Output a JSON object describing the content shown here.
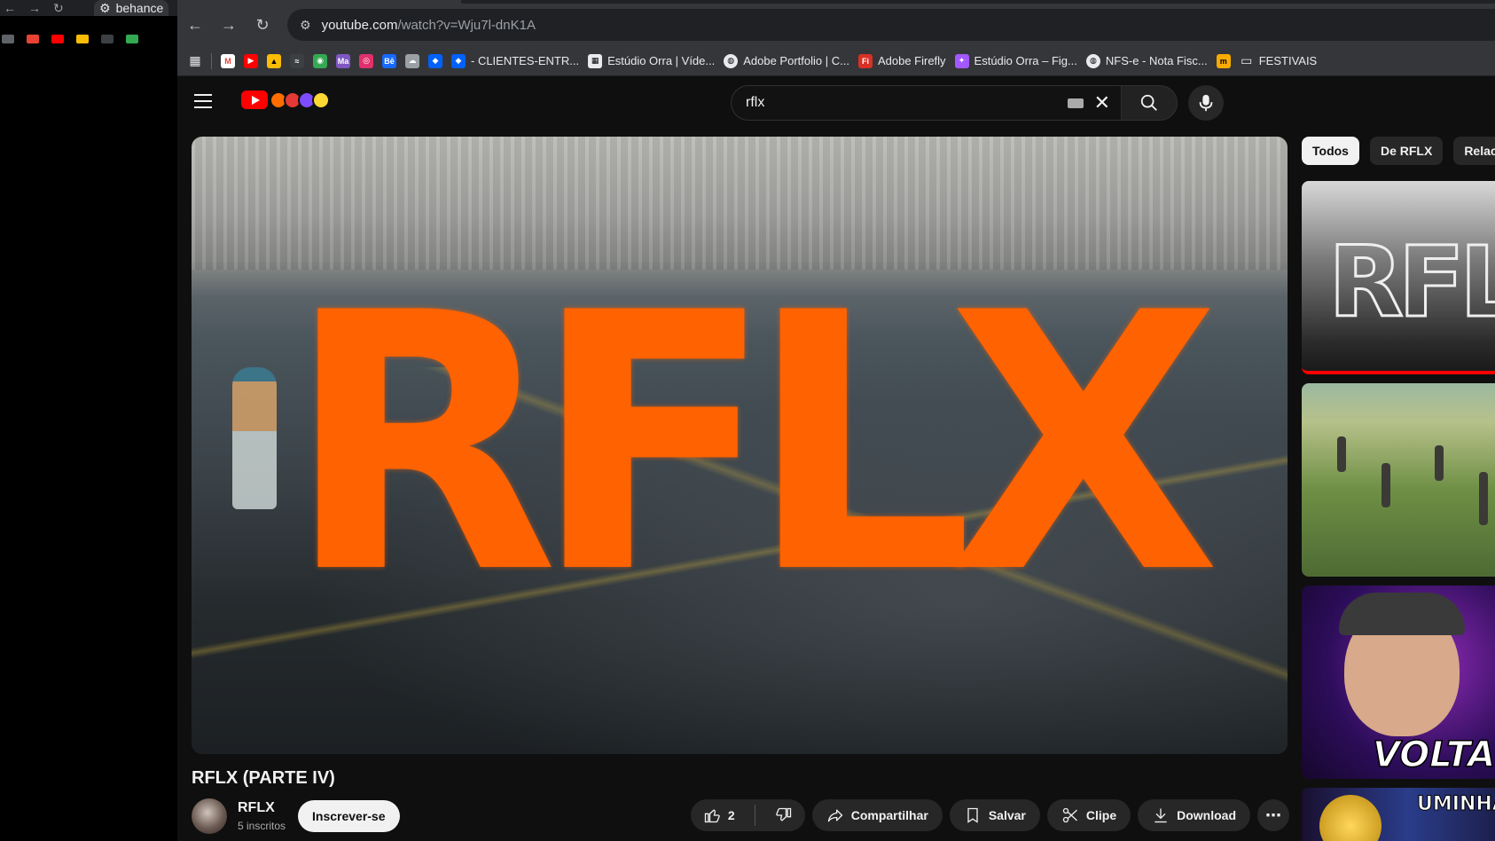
{
  "back_window": {
    "tab_title": "behance"
  },
  "browser": {
    "url_domain": "youtube.com",
    "url_path": "/watch?v=Wju7l-dnK1A",
    "bookmarks": [
      {
        "label": "- CLIENTES-ENTR...",
        "color": "#1a73e8",
        "glyph": "≡"
      },
      {
        "label": "Estúdio Orra | Víde...",
        "color": "#e8eaed",
        "glyph": "▦"
      },
      {
        "label": "Adobe Portfolio | C...",
        "color": "#e8eaed",
        "glyph": "◍"
      },
      {
        "label": "Adobe Firefly",
        "color": "#d93025",
        "glyph": "Fi"
      },
      {
        "label": "Estúdio Orra – Fig...",
        "color": "#a259ff",
        "glyph": "✦"
      },
      {
        "label": "NFS-e - Nota Fisc...",
        "color": "#e8eaed",
        "glyph": "◍"
      },
      {
        "label": "",
        "color": "#f9ab00",
        "glyph": "m"
      },
      {
        "label": "FESTIVAIS",
        "color": "transparent",
        "glyph": "▭"
      }
    ]
  },
  "youtube": {
    "search": {
      "value": "rflx"
    },
    "player": {
      "wordmark": "RFLX"
    },
    "video": {
      "title": "RFLX (PARTE IV)",
      "channel_name": "RFLX",
      "subscribers": "5 inscritos",
      "subscribe_label": "Inscrever-se",
      "likes": "2",
      "share_label": "Compartilhar",
      "save_label": "Salvar",
      "clip_label": "Clipe",
      "download_label": "Download"
    },
    "chips": [
      "Todos",
      "De RFLX",
      "Relacion"
    ],
    "thumbnails": {
      "t3_text": "VOLTA",
      "t4_text": "UMINHA"
    }
  }
}
